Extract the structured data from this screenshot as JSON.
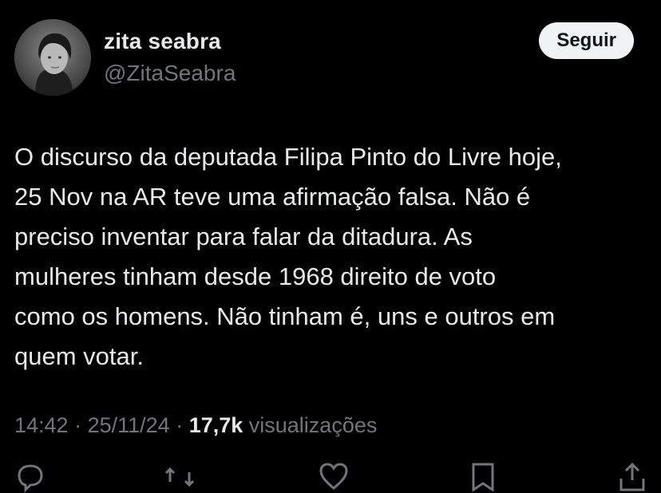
{
  "author": {
    "display_name": "zita seabra",
    "handle": "@ZitaSeabra"
  },
  "follow_button": {
    "label": "Seguir"
  },
  "tweet": {
    "text": "O discurso da deputada Filipa Pinto do Livre hoje,\n25 Nov na AR teve uma afirmação falsa. Não é\npreciso inventar para falar da ditadura. As\nmulheres tinham desde 1968 direito de voto\ncomo os homens. Não tinham é, uns e outros em\nquem votar.",
    "time": "14:42",
    "separator": " · ",
    "date": "25/11/24",
    "views_count": "17,7k",
    "views_label": "visualizações"
  },
  "actions": [
    {
      "icon": "reply-icon"
    },
    {
      "icon": "repost-icon"
    },
    {
      "icon": "like-icon"
    },
    {
      "icon": "bookmark-icon"
    },
    {
      "icon": "share-icon"
    }
  ],
  "colors": {
    "background": "#000000",
    "primary_text": "#e7e9ea",
    "secondary_text": "#71767b",
    "button_bg": "#eff3f4",
    "button_text": "#0f1419"
  }
}
